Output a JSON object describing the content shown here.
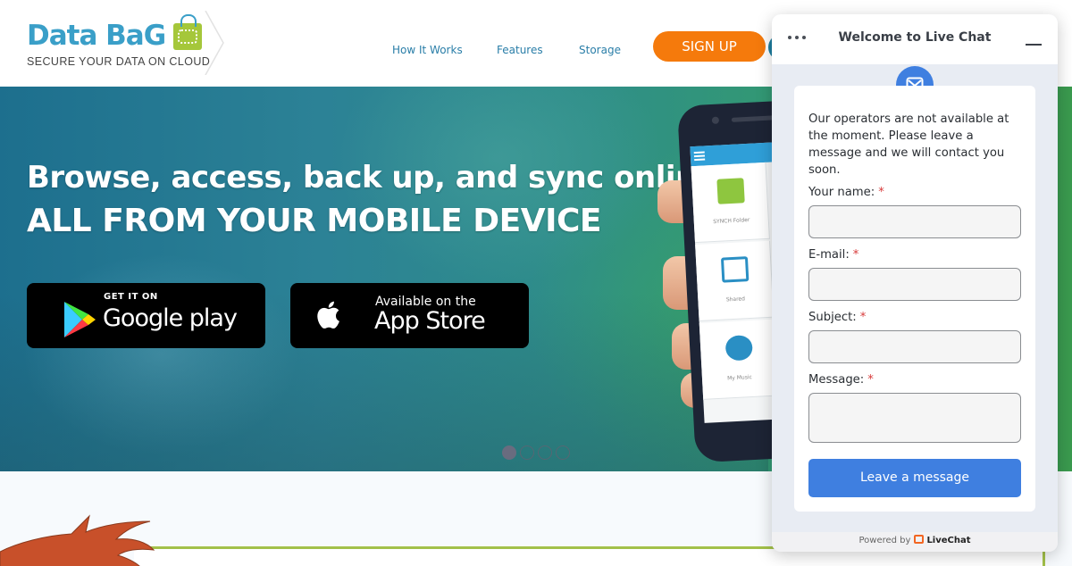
{
  "header": {
    "logo": {
      "title": "Data BaG",
      "tagline": "SECURE YOUR DATA ON CLOUD"
    },
    "nav": [
      {
        "label": "How It Works"
      },
      {
        "label": "Features"
      },
      {
        "label": "Storage"
      }
    ],
    "signup_label": "SIGN UP"
  },
  "hero": {
    "line1": "Browse, access, back up, and sync online",
    "line2": "ALL FROM YOUR MOBILE DEVICE",
    "google_play": {
      "small": "GET IT ON",
      "big": "Google play"
    },
    "app_store": {
      "small": "Available on the",
      "big": "App Store"
    },
    "phone_tiles": [
      {
        "label": "SYNCH Folder"
      },
      {
        "label": "Shared"
      },
      {
        "label": "My Music"
      }
    ],
    "slider": {
      "count": 4,
      "active_index": 0
    }
  },
  "live_chat": {
    "title": "Welcome to Live Chat",
    "intro": "Our operators are not available at the moment. Please leave a message and we will contact you soon.",
    "required_marker": "*",
    "fields": [
      {
        "label": "Your name:",
        "value": "",
        "placeholder": ""
      },
      {
        "label": "E-mail:",
        "value": "",
        "placeholder": ""
      },
      {
        "label": "Subject:",
        "value": "",
        "placeholder": ""
      },
      {
        "label": "Message:",
        "value": "",
        "placeholder": ""
      }
    ],
    "submit_label": "Leave a message",
    "footer": {
      "powered_by": "Powered by",
      "brand": "LiveChat"
    },
    "colors": {
      "accent": "#3f7fe0",
      "required": "#d83a3a",
      "brand": "#f26622"
    }
  },
  "colors": {
    "signup": "#f57a0c",
    "nav_link": "#2a7ea8",
    "logo_blue": "#3a9fc8",
    "logo_green": "#a5c73a",
    "rule_green": "#a3c14a"
  }
}
